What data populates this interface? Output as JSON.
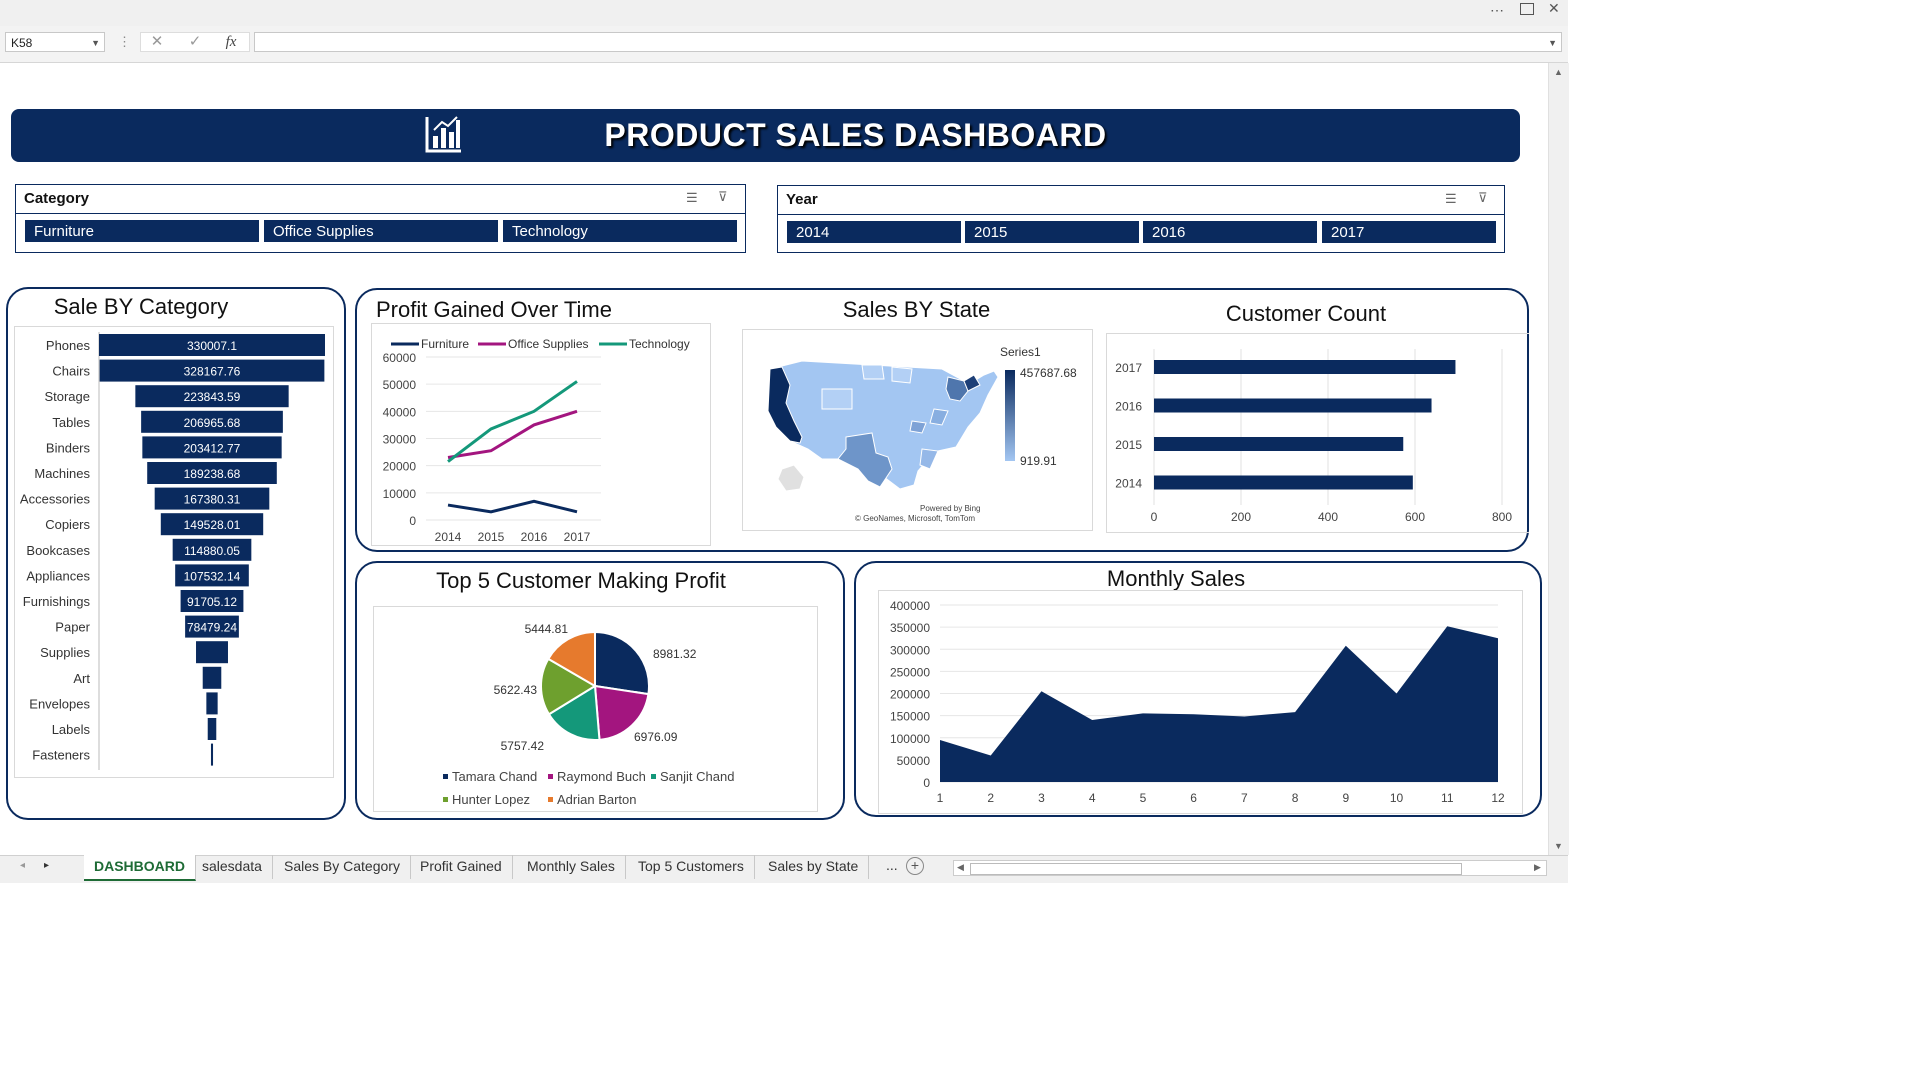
{
  "excel": {
    "name_box": "K58",
    "formula_text": "",
    "tabs": [
      "DASHBOARD",
      "salesdata",
      "Sales By Category",
      "Profit Gained",
      "Monthly Sales",
      "Top 5 Customers",
      "Sales by  State"
    ],
    "active_tab": "DASHBOARD",
    "more_tabs": "..."
  },
  "header": {
    "title": "PRODUCT SALES DASHBOARD",
    "icon": "bar-chart-icon"
  },
  "slicers": {
    "category": {
      "title": "Category",
      "items": [
        "Furniture",
        "Office Supplies",
        "Technology"
      ]
    },
    "year": {
      "title": "Year",
      "items": [
        "2014",
        "2015",
        "2016",
        "2017"
      ]
    }
  },
  "colors": {
    "navy": "#0a2a5e",
    "magenta": "#a3157f",
    "teal": "#14987a",
    "green": "#6ea02e",
    "orange": "#e67a2d"
  },
  "chart_data": [
    {
      "id": "sale_by_category",
      "type": "bar",
      "title": "Sale  BY Category",
      "categories": [
        "Phones",
        "Chairs",
        "Storage",
        "Tables",
        "Binders",
        "Machines",
        "Accessories",
        "Copiers",
        "Bookcases",
        "Appliances",
        "Furnishings",
        "Paper",
        "Supplies",
        "Art",
        "Envelopes",
        "Labels",
        "Fasteners"
      ],
      "values": [
        330007.1,
        328167.76,
        223843.59,
        206965.68,
        203412.77,
        189238.68,
        167380.31,
        149528.01,
        114880.05,
        107532.14,
        91705.12,
        78479.24,
        46673.54,
        27118.79,
        16476.4,
        12486.31,
        3024.28
      ],
      "data_labels": [
        "330007.1",
        "328167.76",
        "223843.59",
        "206965.68",
        "203412.77",
        "189238.68",
        "167380.31",
        "149528.01",
        "114880.05",
        "107532.14",
        "91705.12",
        "78479.24",
        "",
        "",
        "",
        "",
        ""
      ]
    },
    {
      "id": "profit_over_time",
      "type": "line",
      "title": "Profit Gained Over Time",
      "x": [
        "2014",
        "2015",
        "2016",
        "2017"
      ],
      "series": [
        {
          "name": "Furniture",
          "values": [
            5500,
            3000,
            6900,
            3000
          ]
        },
        {
          "name": "Office Supplies",
          "values": [
            23000,
            25500,
            35000,
            40000
          ]
        },
        {
          "name": "Technology",
          "values": [
            21500,
            33500,
            40000,
            51000
          ]
        }
      ],
      "ylim": [
        0,
        60000
      ],
      "yticks": [
        "60000",
        "50000",
        "40000",
        "30000",
        "20000",
        "10000",
        "0"
      ]
    },
    {
      "id": "sales_by_state",
      "type": "map",
      "title": "Sales  BY State",
      "legend_title": "Series1",
      "max": "457687.68",
      "min": "919.91",
      "credit1": "Powered by Bing",
      "credit2": "© GeoNames, Microsoft, TomTom"
    },
    {
      "id": "customer_count",
      "type": "bar",
      "title": "Customer Count",
      "categories": [
        "2017",
        "2016",
        "2015",
        "2014"
      ],
      "values": [
        693,
        638,
        573,
        595
      ],
      "xlim": [
        0,
        800
      ],
      "xticks": [
        "0",
        "200",
        "400",
        "600",
        "800"
      ]
    },
    {
      "id": "top5_customers",
      "type": "pie",
      "title": "Top 5 Customer Making Profit",
      "labels": [
        "Tamara Chand",
        "Raymond Buch",
        "Sanjit Chand",
        "Hunter Lopez",
        "Adrian Barton"
      ],
      "values": [
        8981.32,
        6976.09,
        5757.42,
        5622.43,
        5444.81
      ],
      "value_labels": [
        "8981.32",
        "6976.09",
        "5757.42",
        "5622.43",
        "5444.81"
      ]
    },
    {
      "id": "monthly_sales",
      "type": "area",
      "title": "Monthly Sales",
      "x": [
        "1",
        "2",
        "3",
        "4",
        "5",
        "6",
        "7",
        "8",
        "9",
        "10",
        "11",
        "12"
      ],
      "values": [
        95000,
        60000,
        205000,
        140000,
        155000,
        153000,
        148000,
        158000,
        308000,
        200000,
        352000,
        325000
      ],
      "ylim": [
        0,
        400000
      ],
      "yticks": [
        "400000",
        "350000",
        "300000",
        "250000",
        "200000",
        "150000",
        "100000",
        "50000",
        "0"
      ]
    }
  ]
}
